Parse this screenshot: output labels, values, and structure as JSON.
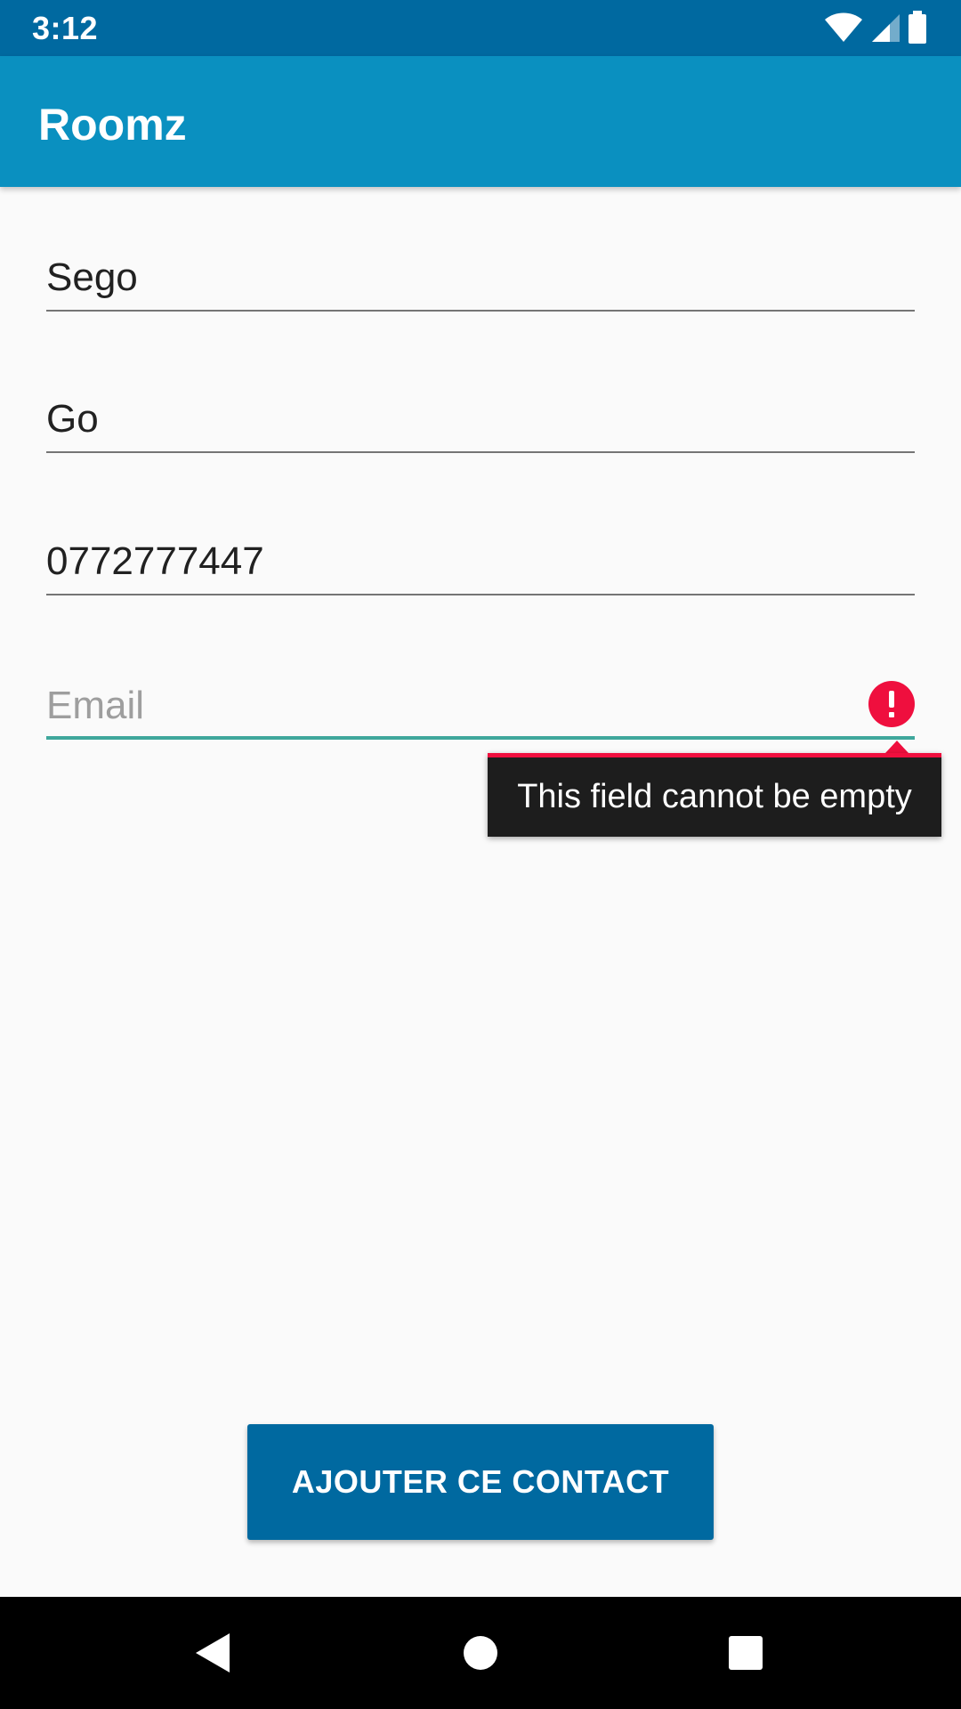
{
  "status_bar": {
    "time": "3:12",
    "icons": [
      "wifi-icon",
      "signal-icon",
      "battery-icon"
    ]
  },
  "app_bar": {
    "title": "Roomz"
  },
  "form": {
    "fields": [
      {
        "name": "first-name",
        "value": "Sego",
        "placeholder": ""
      },
      {
        "name": "last-name",
        "value": "Go",
        "placeholder": ""
      },
      {
        "name": "phone",
        "value": "0772777447",
        "placeholder": ""
      },
      {
        "name": "email",
        "value": "",
        "placeholder": "Email",
        "focused": true,
        "error": "This field cannot be empty",
        "error_icon": "error-exclamation-icon"
      }
    ],
    "submit_label": "AJOUTER CE CONTACT"
  },
  "nav_bar": {
    "buttons": [
      "back-icon",
      "home-icon",
      "recents-icon"
    ]
  },
  "colors": {
    "status_bar": "#0069A0",
    "app_bar": "#0A90C0",
    "background": "#FAFAFA",
    "accent": "#3FA79C",
    "error": "#EF0F3E",
    "button": "#0069A0",
    "tooltip_bg": "#1D1D1D"
  }
}
